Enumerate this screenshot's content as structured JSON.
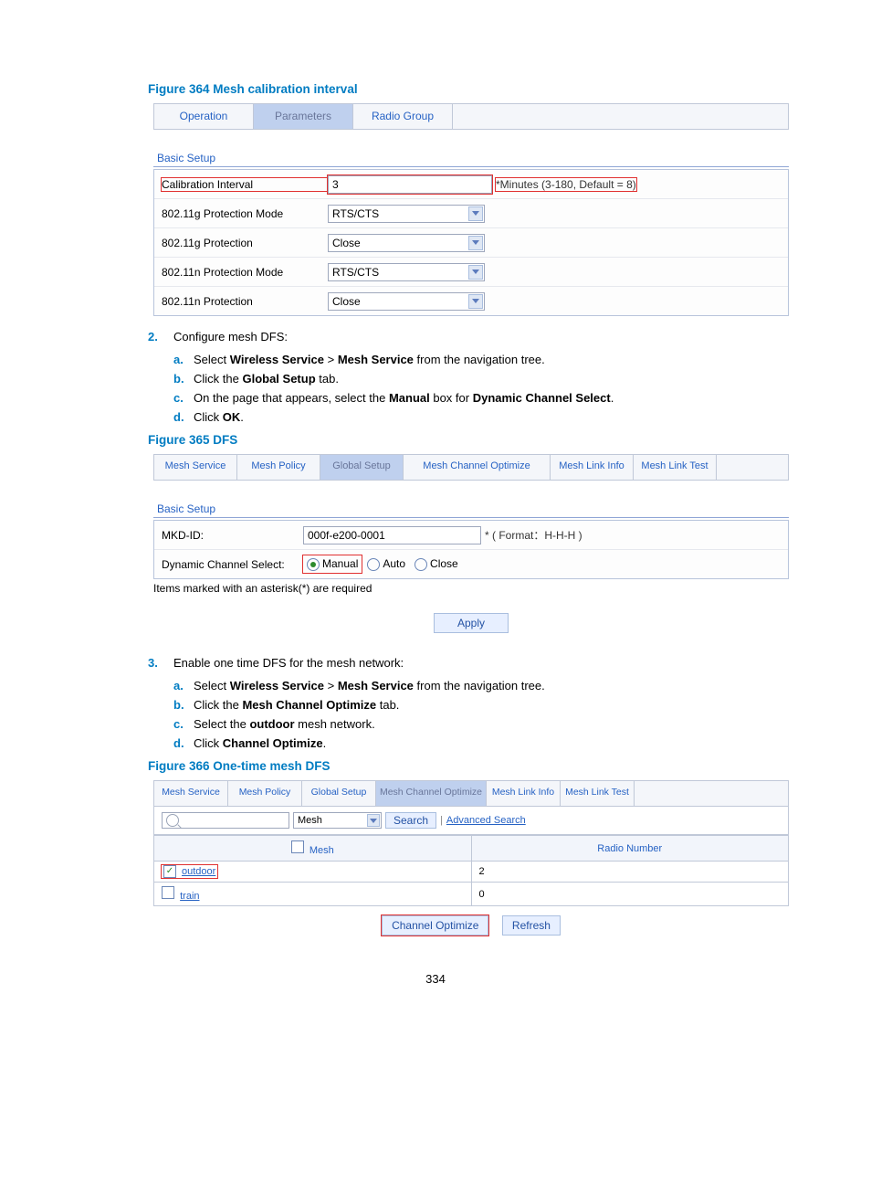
{
  "page_number": "334",
  "fig364": {
    "title": "Figure 364 Mesh calibration interval",
    "tabs": [
      "Operation",
      "Parameters",
      "Radio Group"
    ],
    "section": "Basic Setup",
    "rows": {
      "cal_label": "Calibration Interval",
      "cal_value": "3",
      "cal_hint": "*Minutes (3-180, Default = 8)",
      "gmode_label": "802.11g Protection Mode",
      "gmode_value": "RTS/CTS",
      "gprot_label": "802.11g Protection",
      "gprot_value": "Close",
      "nmode_label": "802.11n Protection Mode",
      "nmode_value": "RTS/CTS",
      "nprot_label": "802.11n Protection",
      "nprot_value": "Close"
    }
  },
  "step2": {
    "num": "2.",
    "text": "Configure mesh DFS:",
    "a": {
      "pre": "Select ",
      "b1": "Wireless Service",
      "mid": " > ",
      "b2": "Mesh Service",
      "post": " from the navigation tree."
    },
    "b": {
      "pre": "Click the ",
      "b1": "Global Setup",
      "post": " tab."
    },
    "c": {
      "pre": "On the page that appears, select the ",
      "b1": "Manual",
      "mid": " box for ",
      "b2": "Dynamic Channel Select",
      "post": "."
    },
    "d": {
      "pre": "Click ",
      "b1": "OK",
      "post": "."
    }
  },
  "fig365": {
    "title": "Figure 365 DFS",
    "tabs": [
      "Mesh Service",
      "Mesh Policy",
      "Global Setup",
      "Mesh Channel Optimize",
      "Mesh Link Info",
      "Mesh Link Test"
    ],
    "section": "Basic Setup",
    "mkd_label": "MKD-ID:",
    "mkd_value": "000f-e200-0001",
    "mkd_hint": "* ( Format：H-H-H )",
    "dcs_label": "Dynamic Channel Select:",
    "dcs_opts": [
      "Manual",
      "Auto",
      "Close"
    ],
    "note": "Items marked with an asterisk(*) are required",
    "apply": "Apply"
  },
  "step3": {
    "num": "3.",
    "text": "Enable one time DFS for the mesh network:",
    "a": {
      "pre": "Select ",
      "b1": "Wireless Service",
      "mid": " > ",
      "b2": "Mesh Service",
      "post": " from the navigation tree."
    },
    "b": {
      "pre": "Click the ",
      "b1": "Mesh Channel Optimize",
      "post": " tab."
    },
    "c": {
      "pre": "Select the ",
      "b1": "outdoor",
      "post": " mesh network."
    },
    "d": {
      "pre": "Click ",
      "b1": "Channel Optimize",
      "post": "."
    }
  },
  "fig366": {
    "title": "Figure 366 One-time mesh DFS",
    "tabs": [
      "Mesh Service",
      "Mesh Policy",
      "Global Setup",
      "Mesh Channel Optimize",
      "Mesh Link Info",
      "Mesh Link Test"
    ],
    "search_sel": "Mesh",
    "search_btn": "Search",
    "adv_search": "Advanced Search",
    "th_mesh": "Mesh",
    "th_radio": "Radio Number",
    "row1_name": "outdoor",
    "row1_radio": "2",
    "row2_name": "train",
    "row2_radio": "0",
    "optimize_btn": "Channel Optimize",
    "refresh_btn": "Refresh"
  }
}
